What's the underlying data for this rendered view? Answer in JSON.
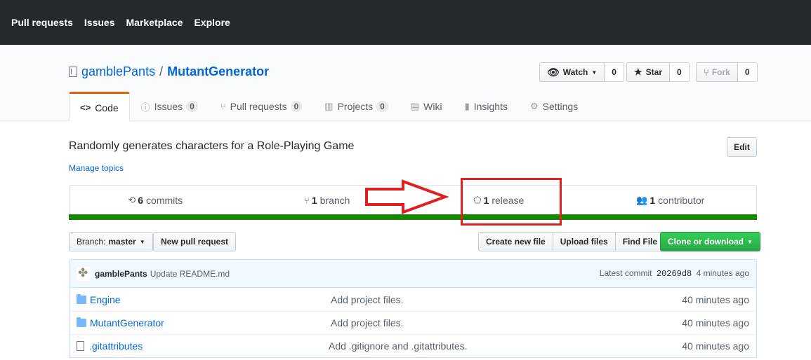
{
  "header": {
    "nav": [
      "Pull requests",
      "Issues",
      "Marketplace",
      "Explore"
    ]
  },
  "repo": {
    "owner": "gamblePants",
    "separator": "/",
    "name": "MutantGenerator",
    "actions": {
      "watch_label": "Watch",
      "watch_count": "0",
      "star_label": "Star",
      "star_count": "0",
      "fork_label": "Fork",
      "fork_count": "0"
    },
    "tabs": [
      {
        "label": "Code",
        "icon": "code-icon",
        "count": ""
      },
      {
        "label": "Issues",
        "icon": "issue-icon",
        "count": "0"
      },
      {
        "label": "Pull requests",
        "icon": "pull-request-icon",
        "count": "0"
      },
      {
        "label": "Projects",
        "icon": "project-icon",
        "count": "0"
      },
      {
        "label": "Wiki",
        "icon": "book-icon",
        "count": ""
      },
      {
        "label": "Insights",
        "icon": "graph-icon",
        "count": ""
      },
      {
        "label": "Settings",
        "icon": "gear-icon",
        "count": ""
      }
    ],
    "description": "Randomly generates characters for a Role-Playing Game",
    "manage_topics": "Manage topics",
    "edit_label": "Edit",
    "summary": {
      "commits_num": "6",
      "commits_label": "commits",
      "branch_num": "1",
      "branch_label": "branch",
      "release_num": "1",
      "release_label": "release",
      "contributor_num": "1",
      "contributor_label": "contributor"
    },
    "language_color": "#178600"
  },
  "file_nav": {
    "branch_prefix": "Branch:",
    "branch_name": "master",
    "new_pr": "New pull request",
    "create_file": "Create new file",
    "upload_files": "Upload files",
    "find_file": "Find File",
    "clone": "Clone or download"
  },
  "commit": {
    "author": "gamblePants",
    "message": "Update README.md",
    "latest_label": "Latest commit",
    "sha": "20269d8",
    "age": "4 minutes ago"
  },
  "files": [
    {
      "type": "dir",
      "name": "Engine",
      "message": "Add project files.",
      "age": "40 minutes ago"
    },
    {
      "type": "dir",
      "name": "MutantGenerator",
      "message": "Add project files.",
      "age": "40 minutes ago"
    },
    {
      "type": "file",
      "name": ".gitattributes",
      "message": "Add .gitignore and .gitattributes.",
      "age": "40 minutes ago"
    }
  ],
  "annotation": {
    "color": "#e02020"
  }
}
